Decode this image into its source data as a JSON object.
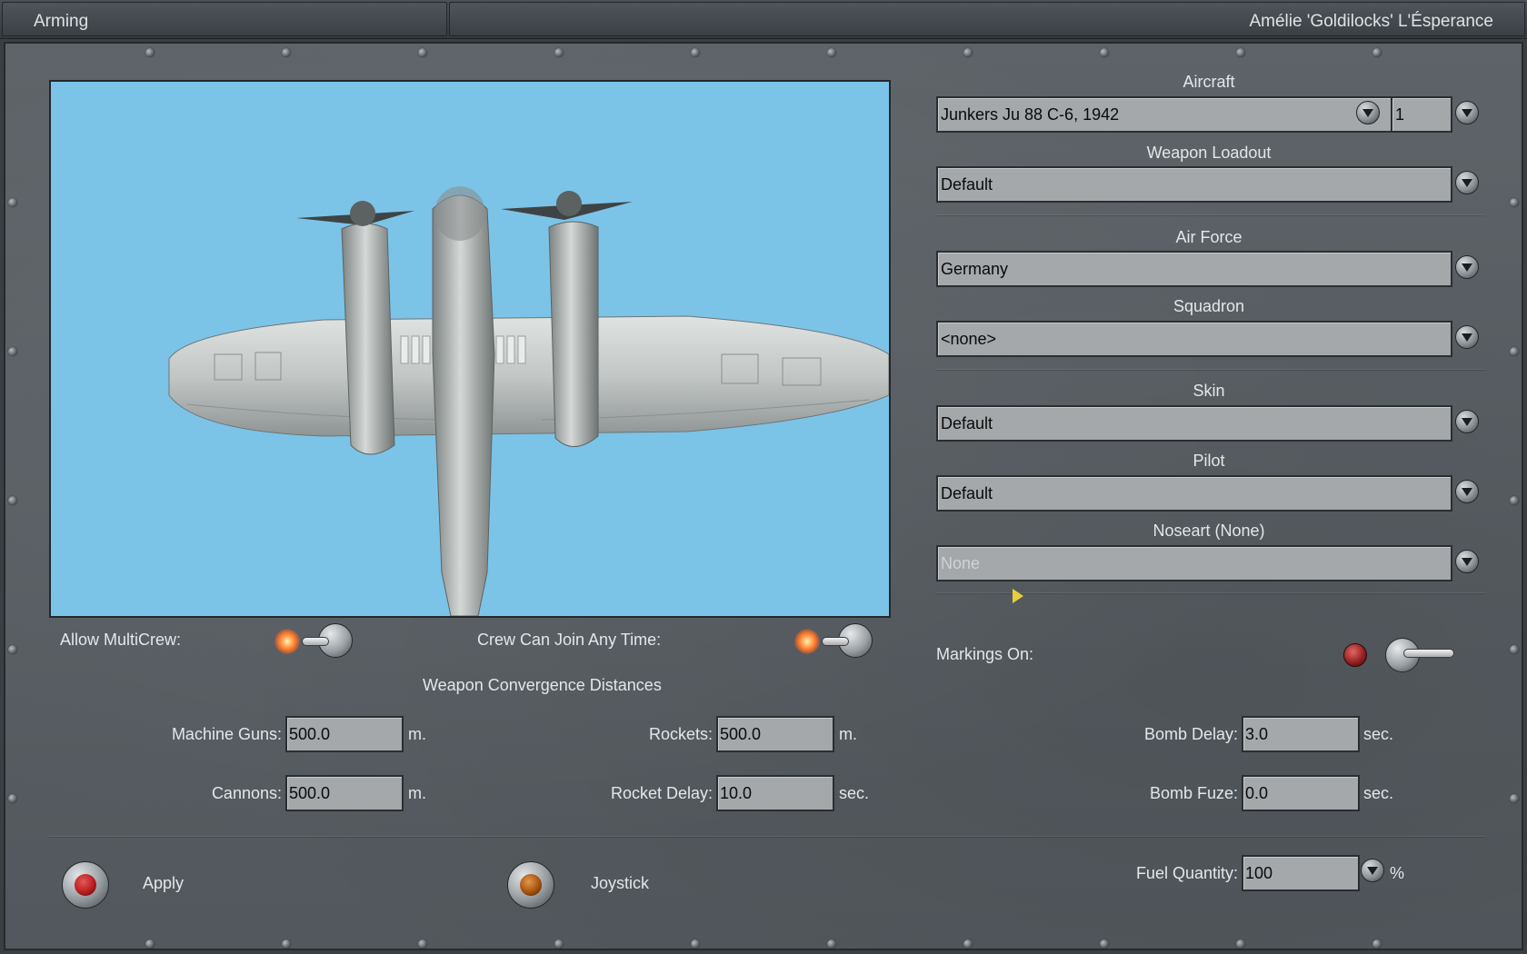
{
  "window": {
    "title": "Arming",
    "user": "Amélie 'Goldilocks' L'Ésperance"
  },
  "aircraft": {
    "label": "Aircraft",
    "value": "Junkers Ju 88 C-6, 1942",
    "count": "1"
  },
  "weapon_loadout": {
    "label": "Weapon Loadout",
    "value": "Default"
  },
  "air_force": {
    "label": "Air Force",
    "value": "Germany"
  },
  "squadron": {
    "label": "Squadron",
    "value": "<none>"
  },
  "skin": {
    "label": "Skin",
    "value": "Default"
  },
  "pilot": {
    "label": "Pilot",
    "value": "Default"
  },
  "noseart": {
    "label": "Noseart (None)",
    "value": "None"
  },
  "toggles": {
    "allow_multicrew": "Allow MultiCrew:",
    "crew_join": "Crew Can Join Any Time:",
    "markings_on": "Markings On:"
  },
  "convergence": {
    "heading": "Weapon Convergence Distances",
    "machine_guns": {
      "label": "Machine Guns:",
      "value": "500.0",
      "unit": "m."
    },
    "cannons": {
      "label": "Cannons:",
      "value": "500.0",
      "unit": "m."
    },
    "rockets": {
      "label": "Rockets:",
      "value": "500.0",
      "unit": "m."
    },
    "rocket_delay": {
      "label": "Rocket Delay:",
      "value": "10.0",
      "unit": "sec."
    },
    "bomb_delay": {
      "label": "Bomb Delay:",
      "value": "3.0",
      "unit": "sec."
    },
    "bomb_fuze": {
      "label": "Bomb Fuze:",
      "value": "0.0",
      "unit": "sec."
    }
  },
  "fuel": {
    "label": "Fuel Quantity:",
    "value": "100",
    "unit": "%"
  },
  "buttons": {
    "apply": "Apply",
    "joystick": "Joystick"
  },
  "colors": {
    "sky": "#7cc3e8",
    "apply_cap": "#b81e1e",
    "joystick_cap": "#a8520e",
    "cursor": "#e7cf3a"
  }
}
